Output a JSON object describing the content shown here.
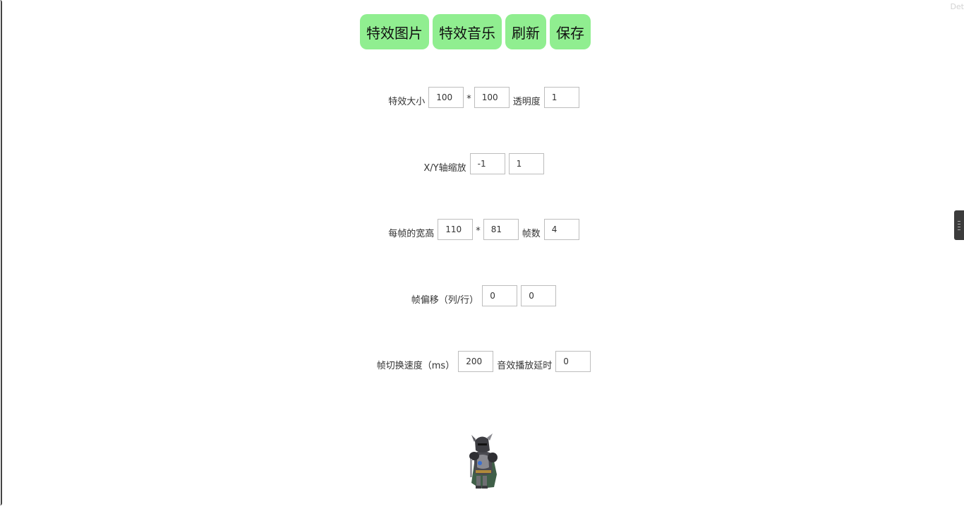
{
  "corner_label": "Det",
  "toolbar": {
    "effect_image": "特效图片",
    "effect_music": "特效音乐",
    "refresh": "刷新",
    "save": "保存"
  },
  "size_row": {
    "label": "特效大小",
    "width": "100",
    "separator": "*",
    "height": "100",
    "opacity_label": "透明度",
    "opacity": "1"
  },
  "scale_row": {
    "label": "X/Y轴缩放",
    "x": "-1",
    "y": "1"
  },
  "frame_row": {
    "label": "每帧的宽高",
    "width": "110",
    "separator": "*",
    "height": "81",
    "count_label": "帧数",
    "count": "4"
  },
  "offset_row": {
    "label": "帧偏移（列/行）",
    "col": "0",
    "row": "0"
  },
  "speed_row": {
    "label": "帧切换速度（ms）",
    "speed": "200",
    "delay_label": "音效播放延时",
    "delay": "0"
  },
  "sprite": {
    "icon": "armored-knight-sprite"
  }
}
